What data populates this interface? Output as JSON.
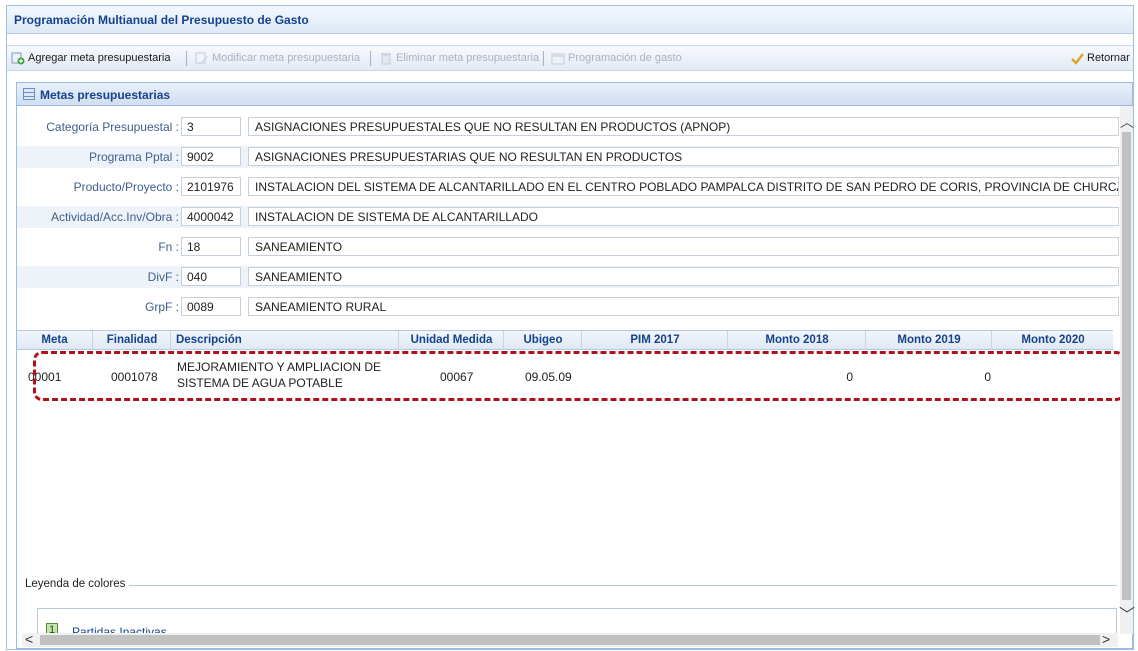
{
  "window": {
    "title": "Programación Multianual del Presupuesto de Gasto"
  },
  "toolbar": {
    "add_label": "Agregar meta presupuestaria",
    "modify_label": "Modificar meta presupuestaria",
    "delete_label": "Eliminar meta presupuestaria",
    "programming_label": "Programación de gasto",
    "return_label": "Retornar"
  },
  "panel": {
    "title": "Metas presupuestarias"
  },
  "form": {
    "categoria": {
      "label": "Categoría Presupuestal :",
      "code": "3",
      "desc": "ASIGNACIONES PRESUPUESTALES QUE NO RESULTAN EN PRODUCTOS (APNOP)"
    },
    "programa": {
      "label": "Programa Pptal :",
      "code": "9002",
      "desc": "ASIGNACIONES PRESUPUESTARIAS QUE NO RESULTAN EN PRODUCTOS"
    },
    "producto": {
      "label": "Producto/Proyecto :",
      "code": "2101976",
      "desc": "INSTALACION DEL SISTEMA DE ALCANTARILLADO EN EL CENTRO POBLADO PAMPALCA DISTRITO DE SAN PEDRO DE CORIS, PROVINCIA DE CHURCAMPA - HI"
    },
    "actividad": {
      "label": "Actividad/Acc.Inv/Obra :",
      "code": "4000042",
      "desc": "INSTALACION DE SISTEMA DE ALCANTARILLADO"
    },
    "fn": {
      "label": "Fn :",
      "code": "18",
      "desc": "SANEAMIENTO"
    },
    "divf": {
      "label": "DivF :",
      "code": "040",
      "desc": "SANEAMIENTO"
    },
    "grpf": {
      "label": "GrpF :",
      "code": "0089",
      "desc": "SANEAMIENTO RURAL"
    }
  },
  "table": {
    "headers": [
      "Meta",
      "Finalidad",
      "Descripción",
      "Unidad Medida",
      "Ubigeo",
      "PIM 2017",
      "Monto 2018",
      "Monto 2019",
      "Monto 2020"
    ],
    "rows": [
      {
        "meta": "00001",
        "finalidad": "0001078",
        "descripcion_1": "MEJORAMIENTO Y AMPLIACION DE",
        "descripcion_2": "SISTEMA DE AGUA POTABLE",
        "unidad": "00067",
        "ubigeo": "09.05.09",
        "pim_2017": "",
        "monto_2018": "0",
        "monto_2019": "0",
        "monto_2020": ""
      }
    ]
  },
  "legend": {
    "title": "Leyenda de colores",
    "items": [
      {
        "swatch": "1",
        "label": "Partidas Inactivas"
      }
    ]
  },
  "colors": {
    "accent": "#15428b",
    "highlight": "#b0121c",
    "inactive_swatch": "#c3e6a8"
  },
  "icons": [
    "add-goal-icon",
    "edit-icon",
    "trash-icon",
    "calendar-icon",
    "return-icon",
    "grid-icon"
  ]
}
